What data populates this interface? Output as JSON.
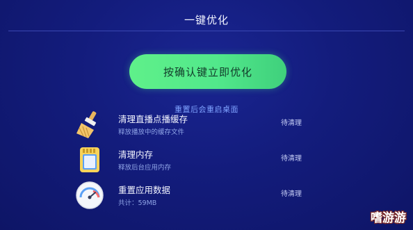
{
  "header": {
    "title": "一键优化"
  },
  "action": {
    "button_label": "按确认键立即优化",
    "note": "重置后会重启桌面"
  },
  "items": [
    {
      "title": "清理直播点播缓存",
      "subtitle": "释放播放中的缓存文件",
      "status": "待清理",
      "icon": "broom-icon"
    },
    {
      "title": "清理内存",
      "subtitle": "释放后台应用内存",
      "status": "待清理",
      "icon": "memory-card-icon"
    },
    {
      "title": "重置应用数据",
      "subtitle": "共计：59MB",
      "status": "待清理",
      "icon": "gauge-icon"
    }
  ],
  "watermark": {
    "text": "嗜游游"
  },
  "colors": {
    "background": "#131c7c",
    "button": "#55e88a",
    "note": "#7fa2ff"
  }
}
